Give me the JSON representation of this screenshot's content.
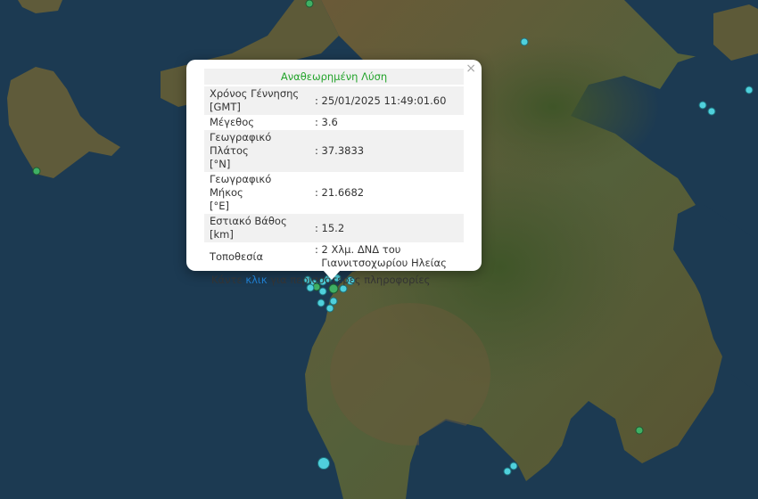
{
  "popup": {
    "title": "Αναθεωρημένη Λύση",
    "close_glyph": "×",
    "rows": [
      {
        "key_line1": "Χρόνος Γέννησης",
        "key_line2": "[GMT]",
        "value_line1": ": 25/01/2025 11:49:01.60",
        "value_line2": ""
      },
      {
        "key_line1": "Μέγεθος",
        "key_line2": "",
        "value_line1": ": 3.6",
        "value_line2": ""
      },
      {
        "key_line1": "Γεωγραφικό Πλάτος",
        "key_line2": "[°N]",
        "value_line1": ": 37.3833",
        "value_line2": ""
      },
      {
        "key_line1": "Γεωγραφικό Μήκος",
        "key_line2": "[°E]",
        "value_line1": ": 21.6682",
        "value_line2": ""
      },
      {
        "key_line1": "Εστιακό Βάθος [km]",
        "key_line2": "",
        "value_line1": ": 15.2",
        "value_line2": ""
      },
      {
        "key_line1": "Τοποθεσία",
        "key_line2": "",
        "value_line1": ": 2 Χλμ. ΔΝΔ του",
        "value_line2": "Γιαννιτσοχωρίου Ηλείας"
      }
    ],
    "more_prefix": "Κάντε ",
    "more_link": "κλικ",
    "more_suffix": " για περισσότερες πληροφορίες"
  },
  "colors": {
    "sea": "#1c3a52",
    "marker_recent": "#4fd0dc",
    "marker_older": "#3fb064",
    "title_green": "#22a32a",
    "link_blue": "#1f7ecf"
  }
}
